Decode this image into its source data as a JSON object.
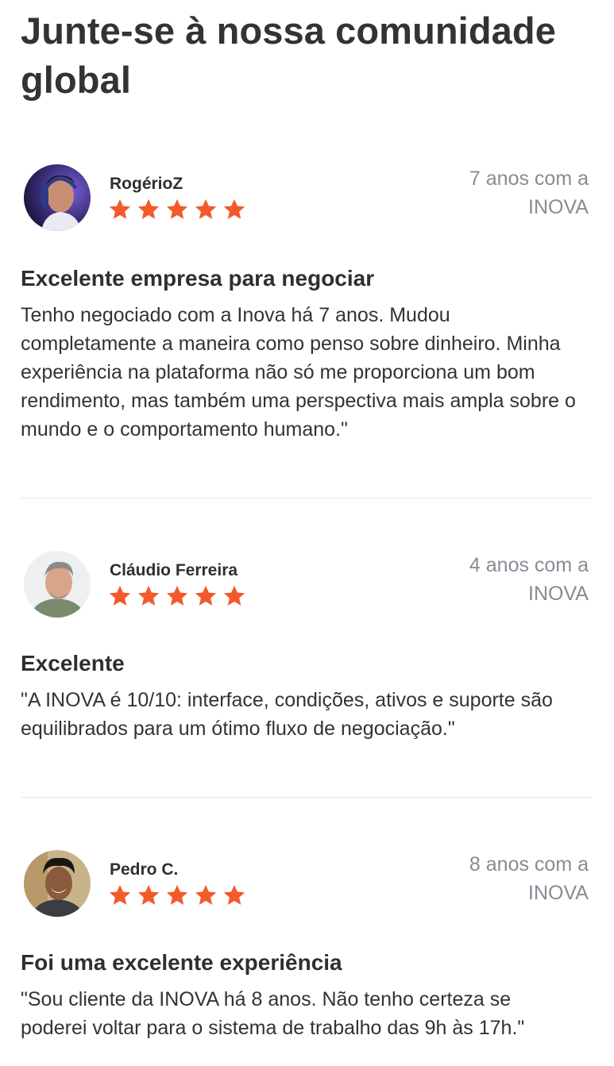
{
  "page": {
    "title": "Junte-se à nossa comunidade global"
  },
  "colors": {
    "star": "#f25a2b",
    "tenure_text": "#8a8a96"
  },
  "reviews": [
    {
      "author": "RogérioZ",
      "rating": 5,
      "tenure": "7 anos com a INOVA",
      "title": "Excelente empresa para negociar",
      "body": "Tenho negociado com a Inova há 7 anos. Mudou completamente a maneira como penso sobre dinheiro. Minha experiência na plataforma não só me proporciona um bom rendimento, mas também uma perspectiva mais ampla sobre o mundo e o comportamento humano.\""
    },
    {
      "author": "Cláudio Ferreira",
      "rating": 5,
      "tenure": "4 anos com a INOVA",
      "title": "Excelente",
      "body": "\"A INOVA é 10/10: interface, condições, ativos e suporte são equilibrados para um ótimo fluxo de negociação.\""
    },
    {
      "author": "Pedro C.",
      "rating": 5,
      "tenure": "8 anos com a INOVA",
      "title": "Foi uma excelente experiência",
      "body": "\"Sou cliente da INOVA há 8 anos. Não tenho certeza se poderei voltar para o sistema de trabalho das 9h às 17h.\""
    }
  ]
}
